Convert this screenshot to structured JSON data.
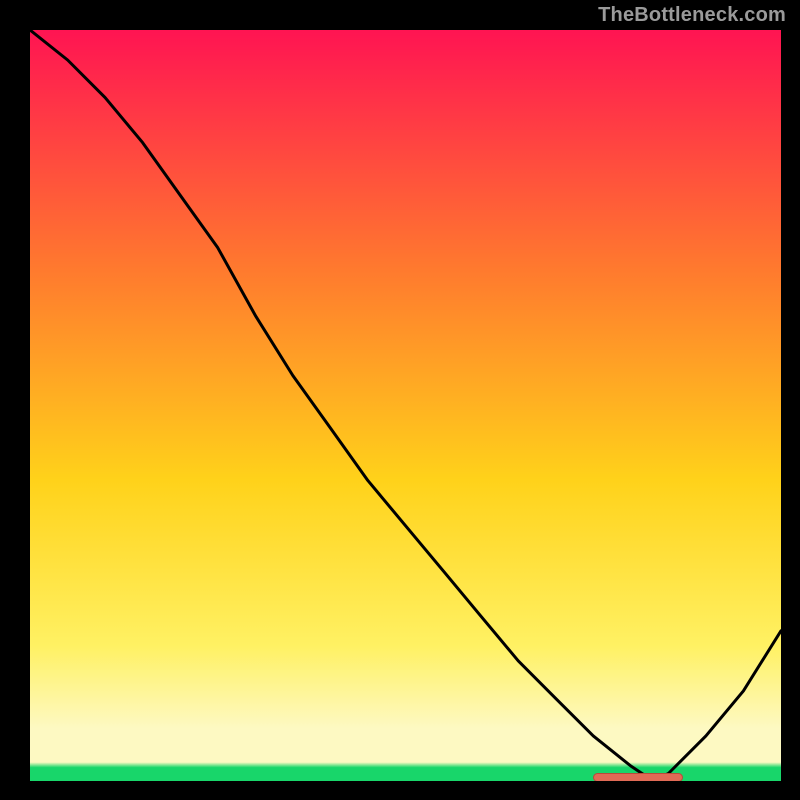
{
  "watermark": "TheBottleneck.com",
  "colors": {
    "top": "#ff1452",
    "mid1": "#ff7a2e",
    "mid2": "#ffd21a",
    "mid3": "#fff163",
    "pale": "#fdf9c2",
    "green": "#18d66a",
    "curve": "#000000",
    "marker": "#e06a55",
    "marker_border": "#b84a3a"
  },
  "chart_data": {
    "type": "line",
    "title": "",
    "xlabel": "",
    "ylabel": "",
    "xlim": [
      0,
      100
    ],
    "ylim": [
      0,
      100
    ],
    "x": [
      0,
      5,
      10,
      15,
      20,
      25,
      30,
      35,
      40,
      45,
      50,
      55,
      60,
      65,
      70,
      75,
      80,
      83,
      85,
      90,
      95,
      100
    ],
    "values": [
      100,
      96,
      91,
      85,
      78,
      71,
      62,
      54,
      47,
      40,
      34,
      28,
      22,
      16,
      11,
      6,
      2,
      0,
      1,
      6,
      12,
      20
    ],
    "marker_band": {
      "x_start": 75,
      "x_end": 87,
      "y": 0.5
    }
  }
}
